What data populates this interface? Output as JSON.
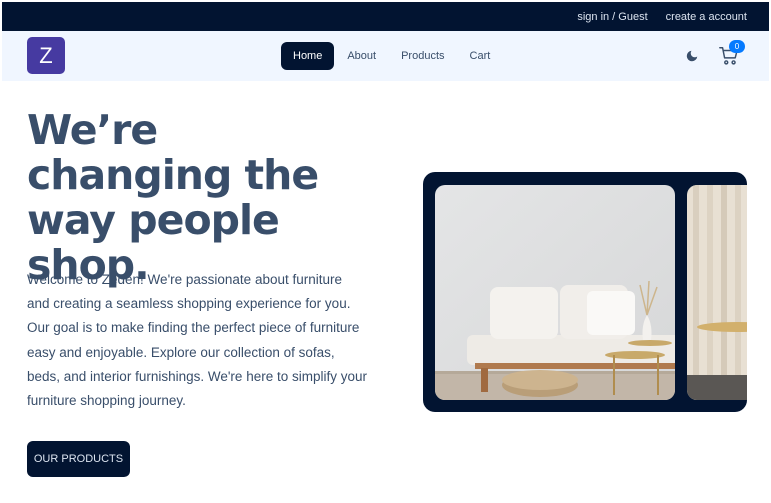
{
  "topbar": {
    "signin": "sign in / Guest",
    "create": "create a account"
  },
  "nav": {
    "logo": "Z",
    "items": [
      {
        "label": "Home",
        "active": true
      },
      {
        "label": "About",
        "active": false
      },
      {
        "label": "Products",
        "active": false
      },
      {
        "label": "Cart",
        "active": false
      }
    ],
    "cart_count": "0",
    "theme_icon": "moon-icon",
    "cart_icon": "cart-icon"
  },
  "hero": {
    "title": "We’re changing the way people shop.",
    "text": "Welcome to Zeden! We're passionate about furniture and creating a seamless shopping experience for you. Our goal is to make finding the perfect piece of furniture easy and enjoyable. Explore our collection of sofas, beds, and interior furnishings. We're here to simplify your furniture shopping journey.",
    "button": "OUR PRODUCTS"
  },
  "colors": {
    "primary": "#021431",
    "navbg": "#f0f6ff",
    "logo": "#463aa1",
    "badge": "#057aff",
    "text": "#394e6a"
  }
}
